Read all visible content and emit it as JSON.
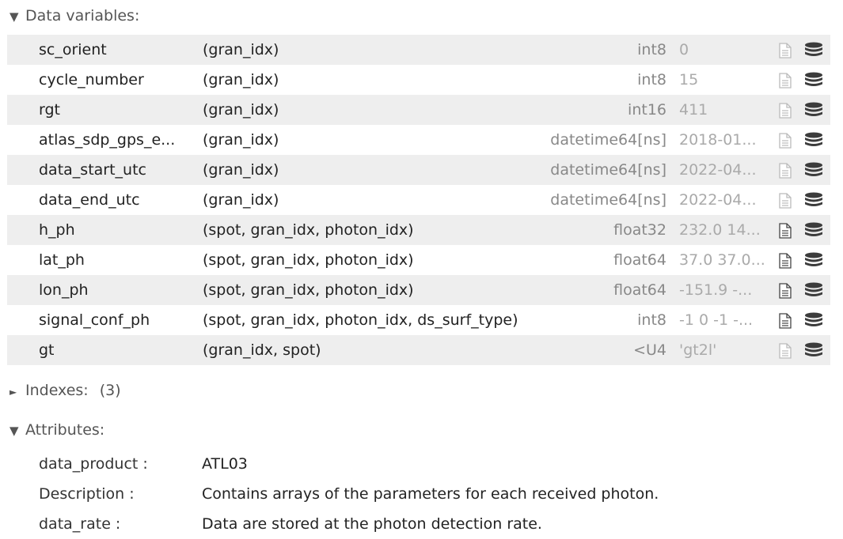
{
  "sections": {
    "data_vars": {
      "label": "Data variables:"
    },
    "indexes": {
      "label": "Indexes:",
      "count": "(3)"
    },
    "attributes": {
      "label": "Attributes:"
    }
  },
  "variables": [
    {
      "name": "sc_orient",
      "dims": "(gran_idx)",
      "dtype": "int8",
      "preview": "0",
      "has_attrs": false
    },
    {
      "name": "cycle_number",
      "dims": "(gran_idx)",
      "dtype": "int8",
      "preview": "15",
      "has_attrs": false
    },
    {
      "name": "rgt",
      "dims": "(gran_idx)",
      "dtype": "int16",
      "preview": "411",
      "has_attrs": false
    },
    {
      "name": "atlas_sdp_gps_e...",
      "dims": "(gran_idx)",
      "dtype": "datetime64[ns]",
      "preview": "2018-01...",
      "has_attrs": false
    },
    {
      "name": "data_start_utc",
      "dims": "(gran_idx)",
      "dtype": "datetime64[ns]",
      "preview": "2022-04...",
      "has_attrs": false
    },
    {
      "name": "data_end_utc",
      "dims": "(gran_idx)",
      "dtype": "datetime64[ns]",
      "preview": "2022-04...",
      "has_attrs": false
    },
    {
      "name": "h_ph",
      "dims": "(spot, gran_idx, photon_idx)",
      "dtype": "float32",
      "preview": "232.0 14...",
      "has_attrs": true
    },
    {
      "name": "lat_ph",
      "dims": "(spot, gran_idx, photon_idx)",
      "dtype": "float64",
      "preview": "37.0 37.0...",
      "has_attrs": true
    },
    {
      "name": "lon_ph",
      "dims": "(spot, gran_idx, photon_idx)",
      "dtype": "float64",
      "preview": "-151.9 -...",
      "has_attrs": true
    },
    {
      "name": "signal_conf_ph",
      "dims": "(spot, gran_idx, photon_idx, ds_surf_type)",
      "dtype": "int8",
      "preview": "-1 0 -1 -...",
      "has_attrs": true
    },
    {
      "name": "gt",
      "dims": "(gran_idx, spot)",
      "dtype": "<U4",
      "preview": "'gt2l'",
      "has_attrs": false
    }
  ],
  "attributes": [
    {
      "key": "data_product :",
      "value": "ATL03"
    },
    {
      "key": "Description :",
      "value": "Contains arrays of the parameters for each received photon."
    },
    {
      "key": "data_rate :",
      "value": "Data are stored at the photon detection rate."
    }
  ],
  "icons": {
    "attrs": "file-text-icon",
    "data": "database-icon"
  },
  "colors": {
    "row_shade": "#eeeeee",
    "icon_active": "#444444",
    "icon_inactive": "#bbbbbb"
  }
}
